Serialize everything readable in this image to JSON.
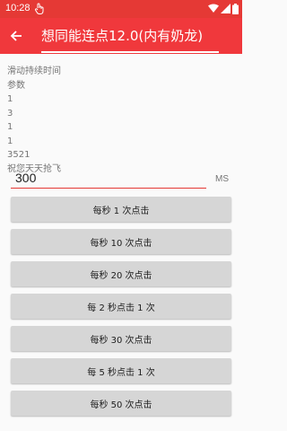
{
  "status_bar": {
    "time": "10:28"
  },
  "app_bar": {
    "title": "想同能连点12.0(内有奶龙)"
  },
  "info_lines": [
    "滑动持续时间",
    "参数",
    "1",
    "3",
    "1",
    "1",
    "3521",
    "祝您天天抢飞"
  ],
  "interval": {
    "value": "300",
    "unit": "MS"
  },
  "buttons": [
    "每秒 1 次点击",
    "每秒 10 次点击",
    "每秒 20 次点击",
    "每 2 秒点击 1 次",
    "每秒 30 次点击",
    "每 5 秒点击 1 次",
    "每秒 50 次点击"
  ],
  "colors": {
    "status_bar": "#e53935",
    "app_bar": "#f0383c",
    "button_bg": "#d6d6d6"
  },
  "icons": {
    "status": [
      "touch-icon",
      "wifi-icon",
      "signal-icon",
      "battery-icon"
    ],
    "navigation": "back-arrow-icon"
  }
}
